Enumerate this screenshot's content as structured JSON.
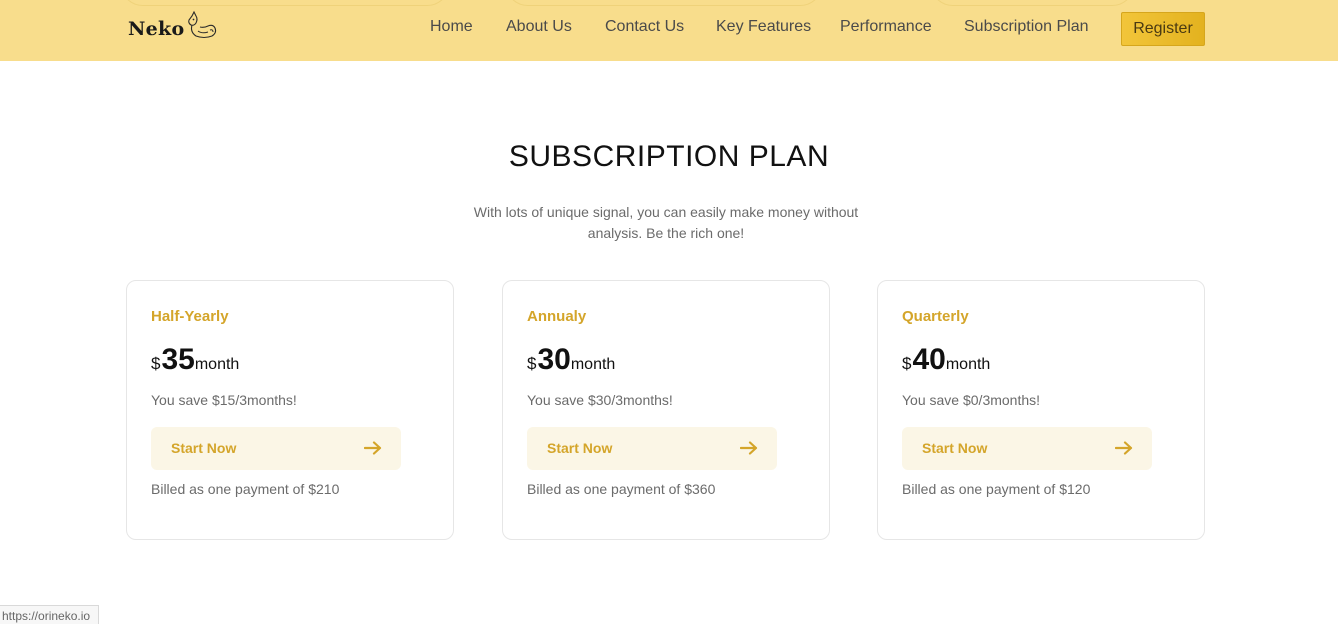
{
  "header": {
    "logo_text": "Neko",
    "nav": [
      {
        "label": "Home"
      },
      {
        "label": "About Us"
      },
      {
        "label": "Contact Us"
      },
      {
        "label": "Key Features"
      },
      {
        "label": "Performance"
      },
      {
        "label": "Subscription Plan"
      }
    ],
    "register_label": "Register"
  },
  "section": {
    "title": "SUBSCRIPTION PLAN",
    "subtitle": "With lots of unique signal, you can easily make money without analysis. Be the rich one!"
  },
  "plans": [
    {
      "name": "Half-Yearly",
      "currency": "$",
      "amount": "35",
      "unit": "month",
      "save_text": "You save $15/3months!",
      "button_label": "Start Now",
      "billed_text": "Billed as one payment of $210"
    },
    {
      "name": "Annualy",
      "currency": "$",
      "amount": "30",
      "unit": "month",
      "save_text": "You save $30/3months!",
      "button_label": "Start Now",
      "billed_text": "Billed as one payment of $360"
    },
    {
      "name": "Quarterly",
      "currency": "$",
      "amount": "40",
      "unit": "month",
      "save_text": "You save $0/3months!",
      "button_label": "Start Now",
      "billed_text": "Billed as one payment of $120"
    }
  ],
  "status_bar": {
    "url": "https://orineko.io"
  },
  "colors": {
    "header_bg": "#f8dd8c",
    "accent": "#d4a52a",
    "button_bg": "#fbf6e6",
    "register_bg": "#f2c53a"
  },
  "icons": {
    "arrow": "arrow-right-icon",
    "logo": "cat-logo-icon"
  }
}
